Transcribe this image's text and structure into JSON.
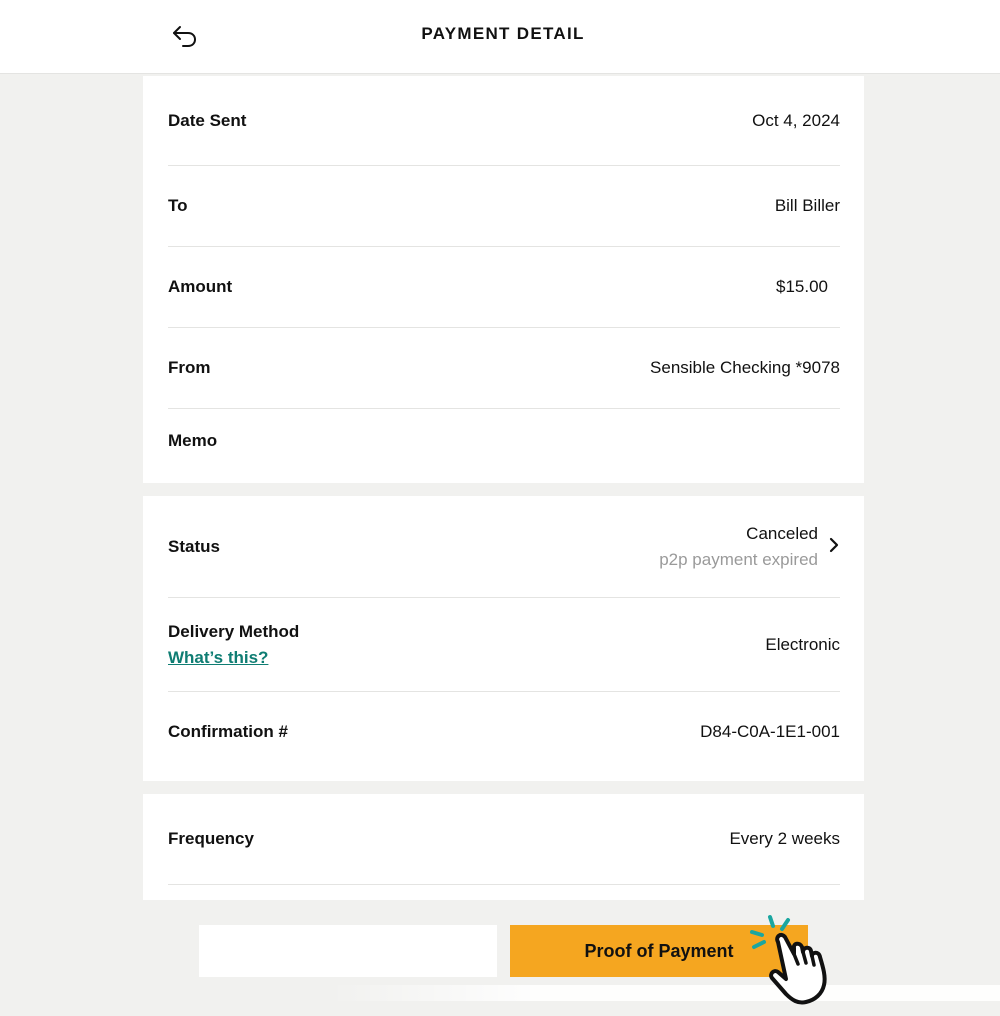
{
  "header": {
    "title": "PAYMENT DETAIL",
    "back_icon": "undo-arrow-icon"
  },
  "details": {
    "date_sent": {
      "label": "Date Sent",
      "value": "Oct 4, 2024"
    },
    "to": {
      "label": "To",
      "value": "Bill Biller"
    },
    "amount": {
      "label": "Amount",
      "value": "$15.00"
    },
    "from": {
      "label": "From",
      "value": "Sensible Checking *9078"
    },
    "memo": {
      "label": "Memo",
      "value": ""
    }
  },
  "status_section": {
    "status": {
      "label": "Status",
      "value": "Canceled",
      "sub": "p2p payment expired",
      "icon": "chevron-right-icon"
    },
    "delivery": {
      "label": "Delivery Method",
      "link": "What’s this?",
      "value": "Electronic"
    },
    "confirmation": {
      "label": "Confirmation #",
      "value": "D84-C0A-1E1-001"
    }
  },
  "schedule": {
    "frequency": {
      "label": "Frequency",
      "value": "Every 2 weeks"
    }
  },
  "actions": {
    "secondary_label": "",
    "proof_label": "Proof of Payment"
  },
  "colors": {
    "accent": "#f5a620",
    "link": "#0f7d73",
    "background": "#f1f1ef",
    "muted": "#9a9a9a"
  }
}
